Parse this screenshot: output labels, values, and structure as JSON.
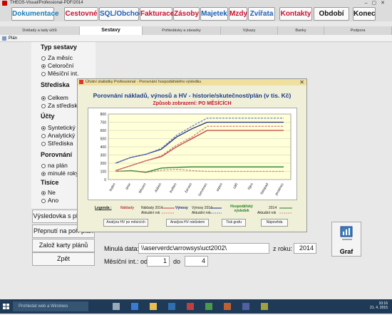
{
  "app": {
    "title": "THEOS-Visual/Professional-PDF/2014"
  },
  "menu": [
    {
      "label": "Dokumentace",
      "color": "#1a7fb4"
    },
    {
      "label": "Cestovné",
      "color": "#c8102e"
    },
    {
      "label": "SQL/Obchod",
      "color": "#1a5fb4"
    },
    {
      "label": "Fakturace",
      "color": "#c8102e"
    },
    {
      "label": "Zásoby",
      "color": "#c8102e"
    },
    {
      "label": "Majetek",
      "color": "#1a5fb4"
    },
    {
      "label": "Mzdy",
      "color": "#c8102e"
    },
    {
      "label": "Zvířata",
      "color": "#1a5fb4"
    },
    {
      "label": "Kontakty",
      "color": "#c8102e"
    },
    {
      "label": "Období",
      "color": "#111111"
    },
    {
      "label": "Konec",
      "color": "#111111"
    }
  ],
  "main_tabs": [
    "Doklady a tady účtů",
    "Sestavy",
    "Pohledávky a závazky",
    "Výkazy",
    "Banky",
    "Podpora"
  ],
  "child_window": {
    "title": "Plán"
  },
  "left": {
    "typ_sestavy": {
      "label": "Typ sestavy",
      "options": [
        "Za měsíc",
        "Celoroční",
        "Měsíční int."
      ],
      "selected": 1
    },
    "strediska": {
      "label": "Střediska",
      "options": [
        "Celkem",
        "Za střediska"
      ],
      "selected": 0
    },
    "ucty": {
      "label": "Účty",
      "options": [
        "Syntetický",
        "Analytický",
        "Střediska"
      ],
      "selected": 0
    },
    "porovnani": {
      "label": "Porovnání",
      "options": [
        "na plán",
        "minulé roky"
      ],
      "selected": 1
    },
    "tisice": {
      "label": "Tisíce",
      "options": [
        "Ne",
        "Ano"
      ],
      "selected": 0
    },
    "buttons": [
      "Výsledovka s plánem",
      "Přepnutí na poř. plán",
      "Založ karty plánů",
      "Zpět"
    ]
  },
  "dialog": {
    "title": "Účetní statistiky Professional - Porovnání hospodářského výsledku",
    "close": "✕",
    "heading": "Porovnání nákladů, výnosů a HV - historie/skutečnost/plán (v tis. Kč)",
    "subheading": "Způsob zobrazení: PO MĚSÍCÍCH",
    "legend": {
      "label": "Legenda :",
      "naklady": "Náklady",
      "naklady_2014": "Náklady 2014",
      "naklady_akt": "Aktuální rok",
      "vynosy": "Výnosy",
      "vynosy_2014": "Výnosy 2014",
      "vynosy_akt": "Aktuální rok",
      "hv": "Hospodářský výsledek",
      "hv_2014": "2014",
      "hv_akt": "Aktuální rok"
    },
    "buttons": [
      "Analýza HV po měsících",
      "Analýza HV nárůstem",
      "Tisk grafu",
      "Nápověda"
    ]
  },
  "chart_data": {
    "type": "line",
    "categories": [
      "leden",
      "únor",
      "březen",
      "duben",
      "květen",
      "červen",
      "červenec",
      "srpen",
      "září",
      "říjen",
      "listopad",
      "prosinec"
    ],
    "ylim": [
      0,
      800
    ],
    "yticks": [
      0,
      100,
      200,
      300,
      400,
      500,
      600,
      700,
      800
    ],
    "grid": true,
    "series": [
      {
        "name": "Výnosy 2014",
        "color": "#203080",
        "values": [
          200,
          270,
          310,
          370,
          520,
          620,
          700,
          700,
          700,
          700,
          700,
          700
        ]
      },
      {
        "name": "Výnosy Aktuální rok",
        "color": "#7080c0",
        "values": [
          200,
          270,
          310,
          380,
          540,
          650,
          750,
          750,
          750,
          750,
          750,
          750
        ]
      },
      {
        "name": "Náklady 2014",
        "color": "#c04040",
        "values": [
          110,
          170,
          230,
          280,
          400,
          500,
          600,
          600,
          600,
          600,
          600,
          600
        ]
      },
      {
        "name": "Náklady Aktuální rok",
        "color": "#d08080",
        "values": [
          110,
          170,
          230,
          290,
          420,
          520,
          650,
          650,
          650,
          650,
          650,
          650
        ]
      },
      {
        "name": "HV 2014",
        "color": "#208020",
        "values": [
          100,
          110,
          90,
          140,
          150,
          155,
          155,
          155,
          155,
          155,
          155,
          155
        ]
      },
      {
        "name": "HV Aktuální rok",
        "color": "#c09090",
        "values": [
          100,
          105,
          85,
          115,
          125,
          110,
          100,
          100,
          100,
          100,
          100,
          100
        ]
      }
    ]
  },
  "bottom": {
    "minula_data_label": "Minulá data:",
    "minula_data_value": "\\\\aserverdc\\arrowsys\\uct2002\\",
    "z_roku_label": "z roku:",
    "z_roku_value": "2014",
    "mesicni_int_label": "Měsíční int.: od",
    "od_value": "1",
    "do_label": "do",
    "do_value": "4",
    "graf_label": "Graf"
  },
  "taskbar": {
    "search_placeholder": "Prohledat web a Windows",
    "time": "10:16",
    "date": "21. 4. 2015"
  }
}
